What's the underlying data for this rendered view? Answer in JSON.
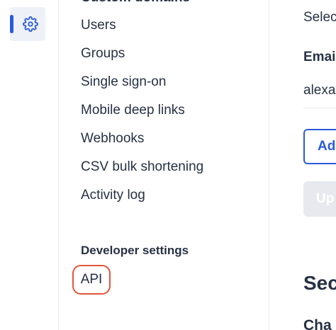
{
  "colors": {
    "accent": "#2a5bd7",
    "highlight_ring": "#e2563c",
    "text": "#273144",
    "border": "#e6e8ec"
  },
  "rail": {
    "settings_icon": "gear-icon"
  },
  "menu": {
    "clipped_heading": "Custom domains",
    "items": [
      "Users",
      "Groups",
      "Single sign-on",
      "Mobile deep links",
      "Webhooks",
      "CSV bulk shortening",
      "Activity log"
    ],
    "developer_heading": "Developer settings",
    "api_label": "API"
  },
  "content": {
    "select_text": "Selec",
    "email_label": "Emai",
    "email_value": "alexa",
    "add_button": "Ad",
    "update_button": "Up",
    "section_title": "Sec",
    "sub_title": "Cha"
  }
}
